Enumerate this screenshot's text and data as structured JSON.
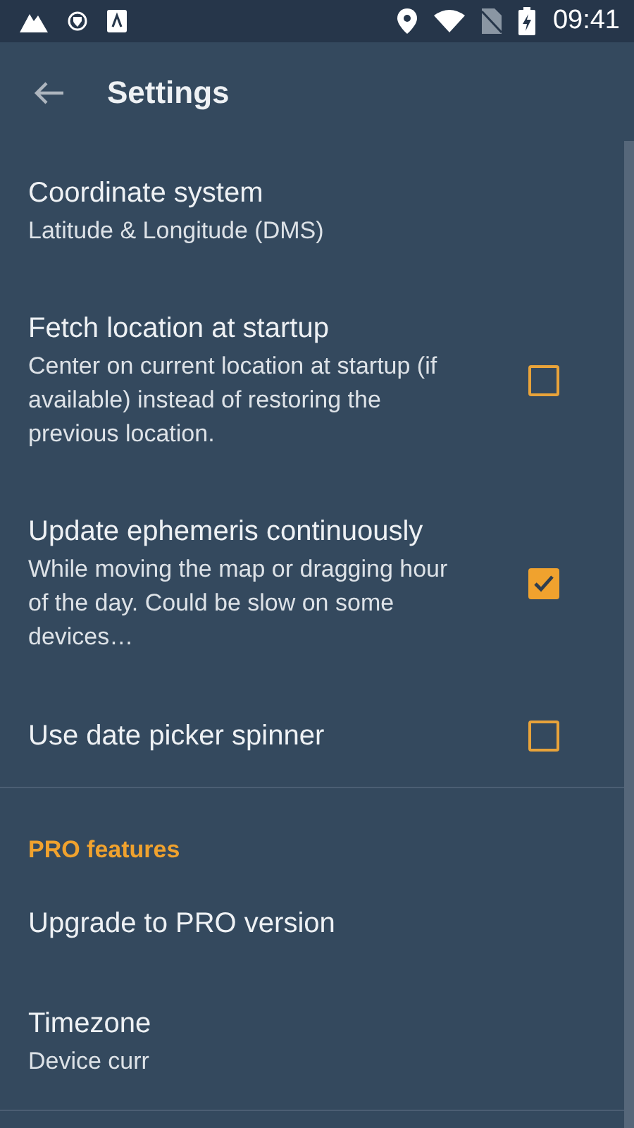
{
  "status_bar": {
    "time": "09:41"
  },
  "toolbar": {
    "title": "Settings"
  },
  "sections": [
    {
      "items": [
        {
          "kind": "plain",
          "title": "Coordinate system",
          "summary": "Latitude & Longitude (DMS)"
        },
        {
          "kind": "checkbox",
          "title": "Fetch location at startup",
          "summary": "Center on current location at startup (if available) instead of restoring the previous location.",
          "checked": false
        },
        {
          "kind": "checkbox",
          "title": "Update ephemeris continuously",
          "summary": "While moving the map or dragging hour of the day. Could be slow on some devices…",
          "checked": true
        },
        {
          "kind": "checkbox",
          "title": "Use date picker spinner",
          "checked": false
        }
      ]
    },
    {
      "header": "PRO features",
      "items": [
        {
          "kind": "plain",
          "title": "Upgrade to PRO version"
        },
        {
          "kind": "plain",
          "title": "Timezone",
          "summary": "Device curr"
        }
      ]
    }
  ]
}
